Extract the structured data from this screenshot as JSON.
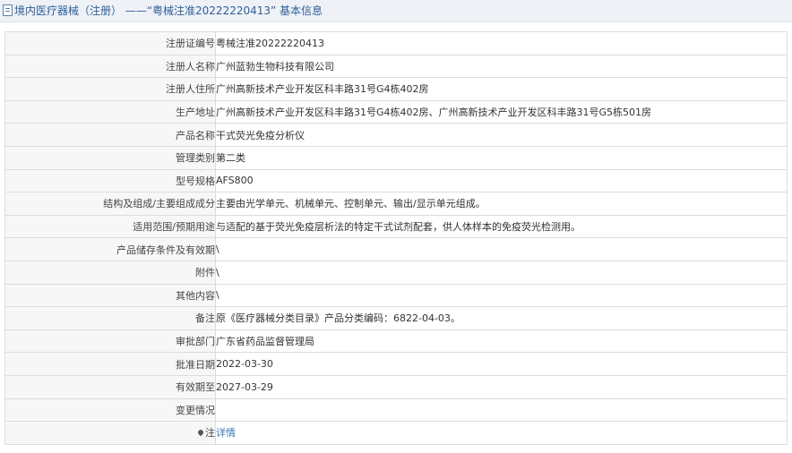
{
  "header": {
    "title": "境内医疗器械（注册） ——“粤械注准20222220413” 基本信息"
  },
  "rows": [
    {
      "label": "注册证编号",
      "value": "粤械注准20222220413"
    },
    {
      "label": "注册人名称",
      "value": "广州蓝勃生物科技有限公司"
    },
    {
      "label": "注册人住所",
      "value": "广州高新技术产业开发区科丰路31号G4栋402房"
    },
    {
      "label": "生产地址",
      "value": "广州高新技术产业开发区科丰路31号G4栋402房、广州高新技术产业开发区科丰路31号G5栋501房"
    },
    {
      "label": "产品名称",
      "value": "干式荧光免疫分析仪"
    },
    {
      "label": "管理类别",
      "value": "第二类"
    },
    {
      "label": "型号规格",
      "value": "AFS800"
    },
    {
      "label": "结构及组成/主要组成成分",
      "value": "主要由光学单元、机械单元、控制单元、输出/显示单元组成。"
    },
    {
      "label": "适用范围/预期用途",
      "value": "与适配的基于荧光免疫层析法的特定干式试剂配套，供人体样本的免疫荧光检测用。"
    },
    {
      "label": "产品储存条件及有效期",
      "value": "\\"
    },
    {
      "label": "附件",
      "value": "\\"
    },
    {
      "label": "其他内容",
      "value": "\\"
    },
    {
      "label": "备注",
      "value": "原《医疗器械分类目录》产品分类编码：6822-04-03。"
    },
    {
      "label": "审批部门",
      "value": "广东省药品监督管理局"
    },
    {
      "label": "批准日期",
      "value": "2022-03-30"
    },
    {
      "label": "有效期至",
      "value": "2027-03-29"
    },
    {
      "label": "变更情况",
      "value": ""
    }
  ],
  "note": {
    "label": "注",
    "link_text": "详情",
    "icon": "pin-icon"
  }
}
